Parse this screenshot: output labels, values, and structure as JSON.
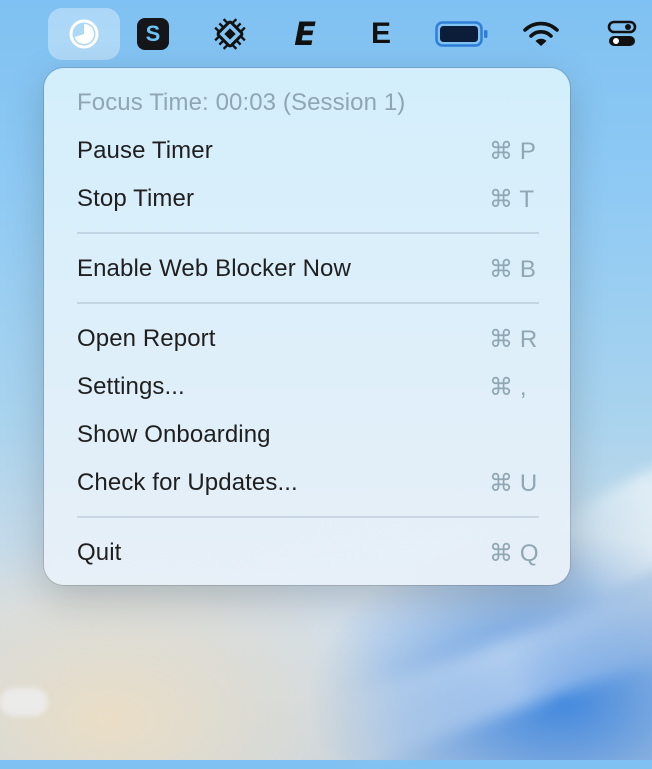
{
  "menubar": {
    "icons": [
      {
        "name": "focus-timer-icon",
        "active": true
      },
      {
        "name": "s-app-icon",
        "glyph": "S"
      },
      {
        "name": "chip-app-icon"
      },
      {
        "name": "e-italic-app-icon",
        "glyph": "E"
      },
      {
        "name": "e-app-icon",
        "glyph": "E"
      },
      {
        "name": "battery-icon"
      },
      {
        "name": "wifi-icon"
      },
      {
        "name": "control-center-icon"
      }
    ]
  },
  "menu": {
    "status": "Focus Time: 00:03 (Session 1)",
    "items": [
      {
        "label": "Pause Timer",
        "shortcut": "⌘ P"
      },
      {
        "label": "Stop Timer",
        "shortcut": "⌘ T"
      },
      {
        "label": "Enable Web Blocker Now",
        "shortcut": "⌘ B"
      },
      {
        "label": "Open Report",
        "shortcut": "⌘ R"
      },
      {
        "label": "Settings...",
        "shortcut": "⌘ ,"
      },
      {
        "label": "Show Onboarding",
        "shortcut": ""
      },
      {
        "label": "Check for Updates...",
        "shortcut": "⌘ U"
      },
      {
        "label": "Quit",
        "shortcut": "⌘ Q"
      }
    ]
  },
  "colors": {
    "menu_bg": "#d8eefa",
    "disabled_text": "#8fa6b3",
    "text": "#1f1f1f",
    "battery_fill": "#0c1d3a",
    "battery_outline": "#2f7fd8"
  }
}
